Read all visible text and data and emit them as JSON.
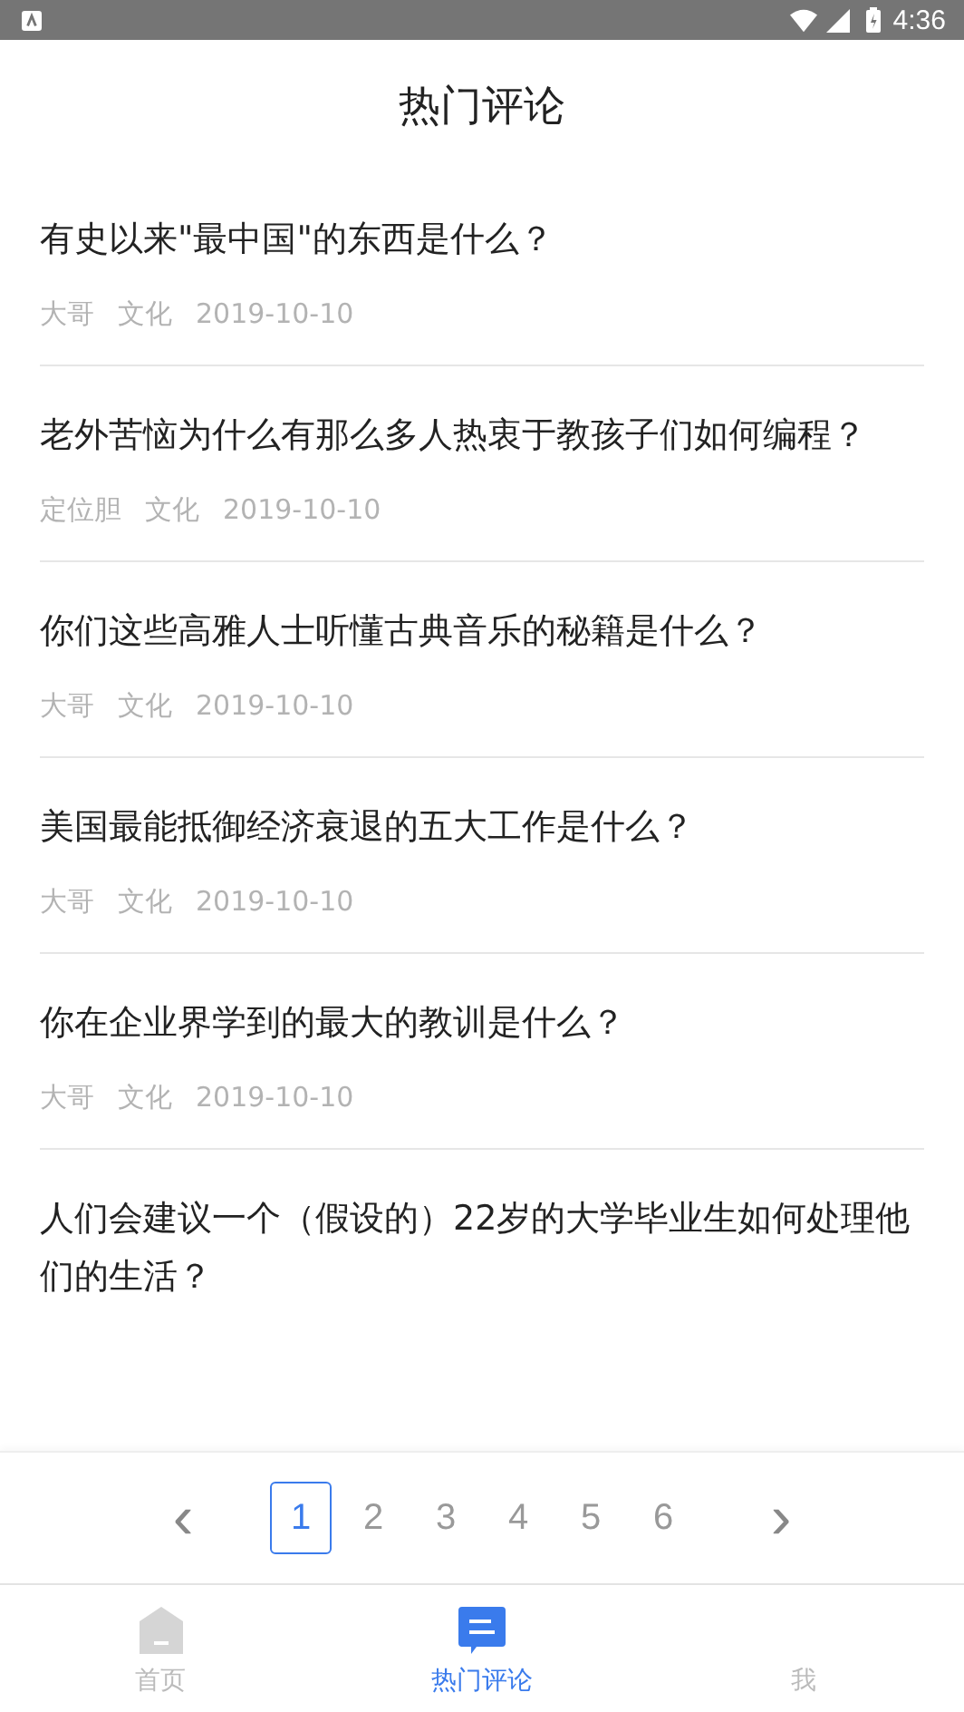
{
  "status_bar": {
    "time": "4:36"
  },
  "title": "热门评论",
  "posts": [
    {
      "question": "有史以来\"最中国\"的东西是什么？",
      "author": "大哥",
      "category": "文化",
      "date": "2019-10-10"
    },
    {
      "question": "老外苦恼为什么有那么多人热衷于教孩子们如何编程？",
      "author": "定位胆",
      "category": "文化",
      "date": "2019-10-10"
    },
    {
      "question": "你们这些高雅人士听懂古典音乐的秘籍是什么？",
      "author": "大哥",
      "category": "文化",
      "date": "2019-10-10"
    },
    {
      "question": "美国最能抵御经济衰退的五大工作是什么？",
      "author": "大哥",
      "category": "文化",
      "date": "2019-10-10"
    },
    {
      "question": "你在企业界学到的最大的教训是什么？",
      "author": "大哥",
      "category": "文化",
      "date": "2019-10-10"
    },
    {
      "question": "人们会建议一个（假设的）22岁的大学毕业生如何处理他们的生活？"
    }
  ],
  "pagination": {
    "prev": "‹",
    "next": "›",
    "pages": [
      {
        "label": "1",
        "selected": true
      },
      {
        "label": "2",
        "selected": false
      },
      {
        "label": "3",
        "selected": false
      },
      {
        "label": "4",
        "selected": false
      },
      {
        "label": "5",
        "selected": false
      },
      {
        "label": "6",
        "selected": false
      }
    ]
  },
  "tabs": [
    {
      "label": "首页",
      "kind": "home",
      "selected": false
    },
    {
      "label": "热门评论",
      "kind": "comments",
      "selected": true
    },
    {
      "label": "我",
      "kind": "none",
      "selected": false
    }
  ]
}
